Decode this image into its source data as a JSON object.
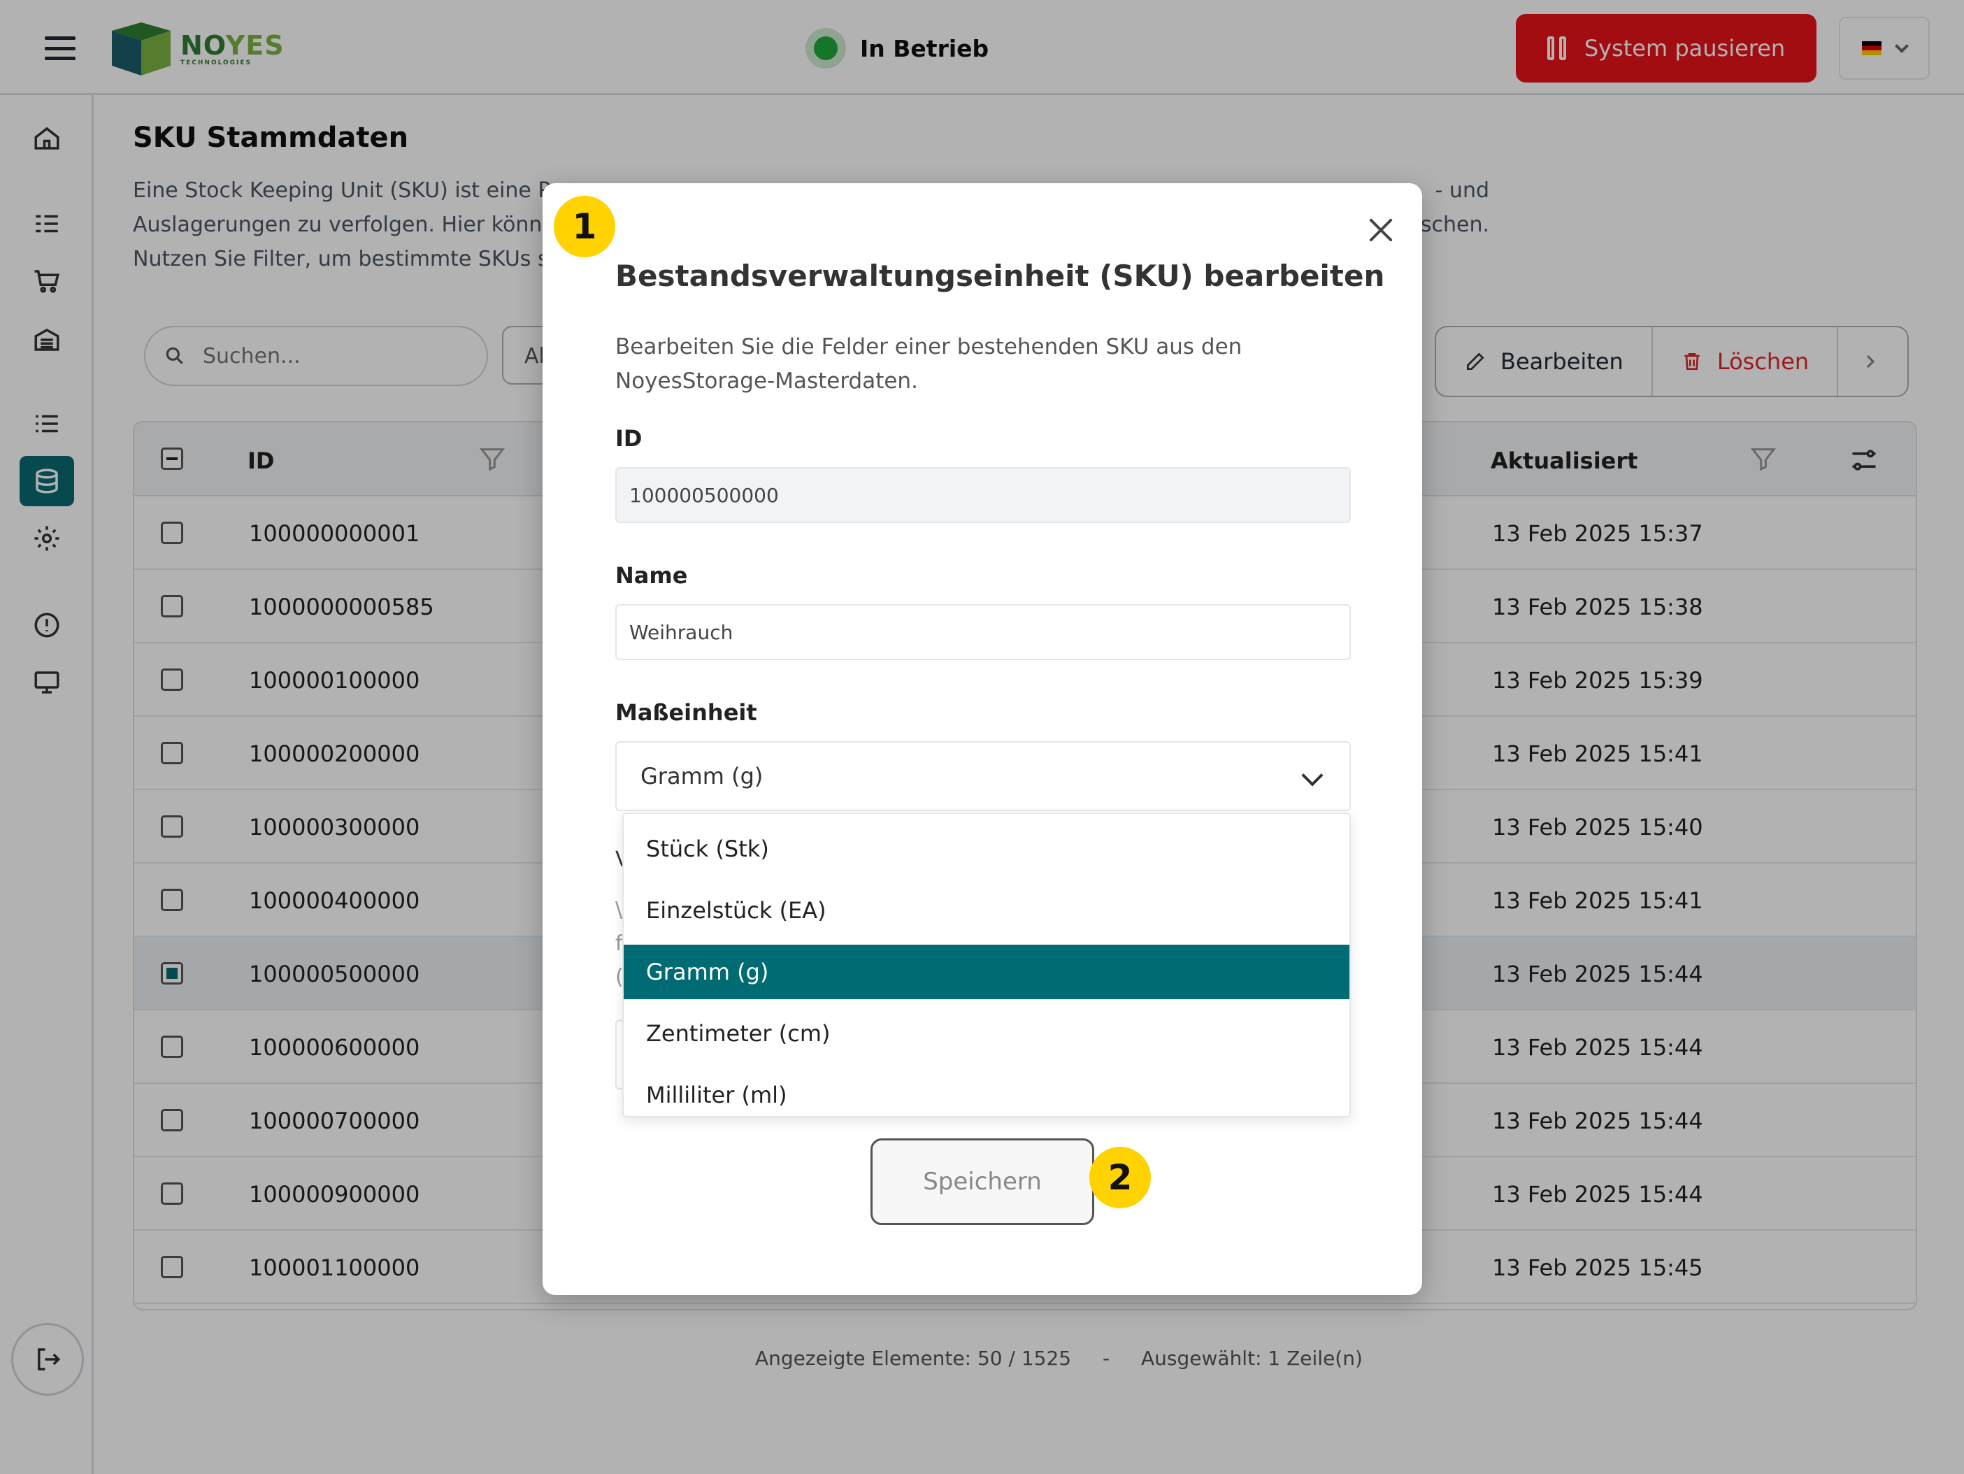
{
  "topbar": {
    "menu_icon": "hamburger-icon",
    "logo_brand_a": "NO",
    "logo_brand_b": "YES",
    "logo_sub": "TECHNOLOGIES",
    "status_text": "In Betrieb",
    "status_color": "#1fa83a",
    "pause_label": "System pausieren",
    "pause_color": "#e8141b",
    "language_flag": "de-flag-icon"
  },
  "sidebar": {
    "items": [
      "home-icon",
      "task-list-icon",
      "cart-icon",
      "storage-icon",
      "list-icon",
      "database-icon",
      "settings-icon",
      "alert-icon",
      "monitor-icon"
    ],
    "active": "database-icon",
    "logout_icon": "logout-icon",
    "accent": "#0a6b72"
  },
  "page": {
    "title": "SKU Stammdaten",
    "desc_line1_a": "Eine Stock Keeping Unit (SKU) ist eine Pr",
    "desc_line1_b": "- und",
    "desc_line2_a": "Auslagerungen zu verfolgen. Hier könne",
    "desc_line2_b": "schen.",
    "desc_line3_a": "Nutzen Sie Filter, um bestimmte SKUs so",
    "search_placeholder": "Suchen...",
    "filter_chip": "Al",
    "edit_label": "Bearbeiten",
    "delete_label": "Löschen"
  },
  "table": {
    "col_id": "ID",
    "col_updated": "Aktualisiert",
    "rows": [
      {
        "id": "100000000001",
        "updated": "13 Feb 2025 15:37",
        "selected": false
      },
      {
        "id": "1000000000585",
        "updated": "13 Feb 2025 15:38",
        "selected": false
      },
      {
        "id": "100000100000",
        "updated": "13 Feb 2025 15:39",
        "selected": false
      },
      {
        "id": "100000200000",
        "updated": "13 Feb 2025 15:41",
        "selected": false
      },
      {
        "id": "100000300000",
        "updated": "13 Feb 2025 15:40",
        "selected": false
      },
      {
        "id": "100000400000",
        "updated": "13 Feb 2025 15:41",
        "selected": false
      },
      {
        "id": "100000500000",
        "updated": "13 Feb 2025 15:44",
        "selected": true
      },
      {
        "id": "100000600000",
        "updated": "13 Feb 2025 15:44",
        "selected": false
      },
      {
        "id": "100000700000",
        "updated": "13 Feb 2025 15:44",
        "selected": false
      },
      {
        "id": "100000900000",
        "updated": "13 Feb 2025 15:44",
        "selected": false
      },
      {
        "id": "100001100000",
        "updated": "13 Feb 2025 15:45",
        "selected": false
      }
    ],
    "footer_shown": "Angezeigte Elemente: 50 / 1525",
    "footer_sep": "-",
    "footer_selected": "Ausgewählt: 1 Zeile(n)"
  },
  "dialog": {
    "title": "Bestandsverwaltungseinheit (SKU) bearbeiten",
    "desc_line1": "Bearbeiten Sie die Felder einer bestehenden SKU aus den",
    "desc_line2": "NoyesStorage-Masterdaten.",
    "id_label": "ID",
    "id_value": "100000500000",
    "name_label": "Name",
    "name_value": "Weihrauch",
    "unit_label": "Maßeinheit",
    "unit_value": "Gramm (g)",
    "unit_options": [
      "Stück (Stk)",
      "Einzelstück (EA)",
      "Gramm (g)",
      "Zentimeter (cm)",
      "Milliliter (ml)"
    ],
    "selected_option": "Gramm (g)",
    "save_label": "Speichern",
    "selected_color": "#006b72"
  },
  "callouts": {
    "one": "1",
    "two": "2",
    "color": "#ffd200"
  }
}
